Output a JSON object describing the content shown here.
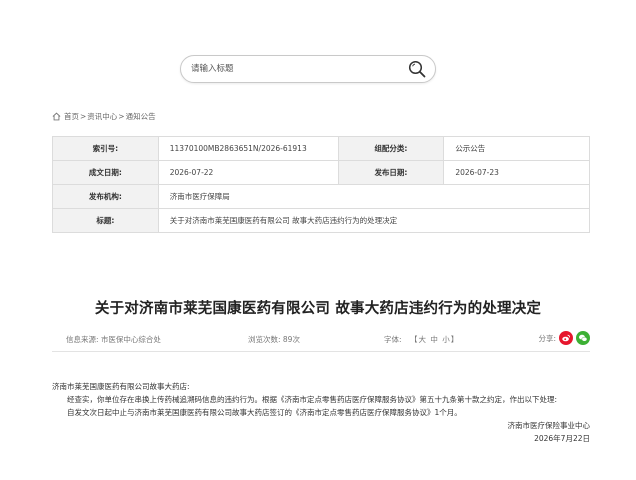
{
  "search": {
    "placeholder": "请输入标题"
  },
  "breadcrumb": {
    "home": "首页",
    "sep": ">",
    "center": "资讯中心",
    "current": "通知公告"
  },
  "meta": {
    "rows": [
      {
        "l1": "索引号:",
        "v1": "11370100MB2863651N/2026-61913",
        "l2": "组配分类:",
        "v2": "公示公告"
      },
      {
        "l1": "成文日期:",
        "v1": "2026-07-22",
        "l2": "发布日期:",
        "v2": "2026-07-23"
      },
      {
        "l1": "发布机构:",
        "v1": "济南市医疗保障局"
      },
      {
        "l1": "标题:",
        "v1": "关于对济南市莱芜国康医药有限公司 故事大药店违约行为的处理决定"
      }
    ]
  },
  "article": {
    "title": "关于对济南市莱芜国康医药有限公司 故事大药店违约行为的处理决定",
    "source": "信息来源: 市医保中心综合处",
    "views": "浏览次数: 89次",
    "font_label": "字体:",
    "font_sizes": "【大 中 小】",
    "share_label": "分享:",
    "body": {
      "addressee": "济南市莱芜国康医药有限公司故事大药店:",
      "p1": "经查实，你单位存在串换上传药械追溯码信息的违约行为。根据《济南市定点零售药店医疗保障服务协议》第五十九条第十款之约定，作出以下处理:",
      "p2": "自发文次日起中止与济南市莱芜国康医药有限公司故事大药店签订的《济南市定点零售药店医疗保障服务协议》1个月。",
      "signature": "济南市医疗保险事业中心",
      "date": "2026年7月22日"
    }
  },
  "icons": {
    "search": "search-icon",
    "home": "home-icon",
    "weibo": "weibo-icon",
    "wechat": "wechat-icon"
  },
  "colors": {
    "weibo": "#e6162d",
    "wechat": "#3cb034",
    "label_bg": "#f2f2f2"
  }
}
